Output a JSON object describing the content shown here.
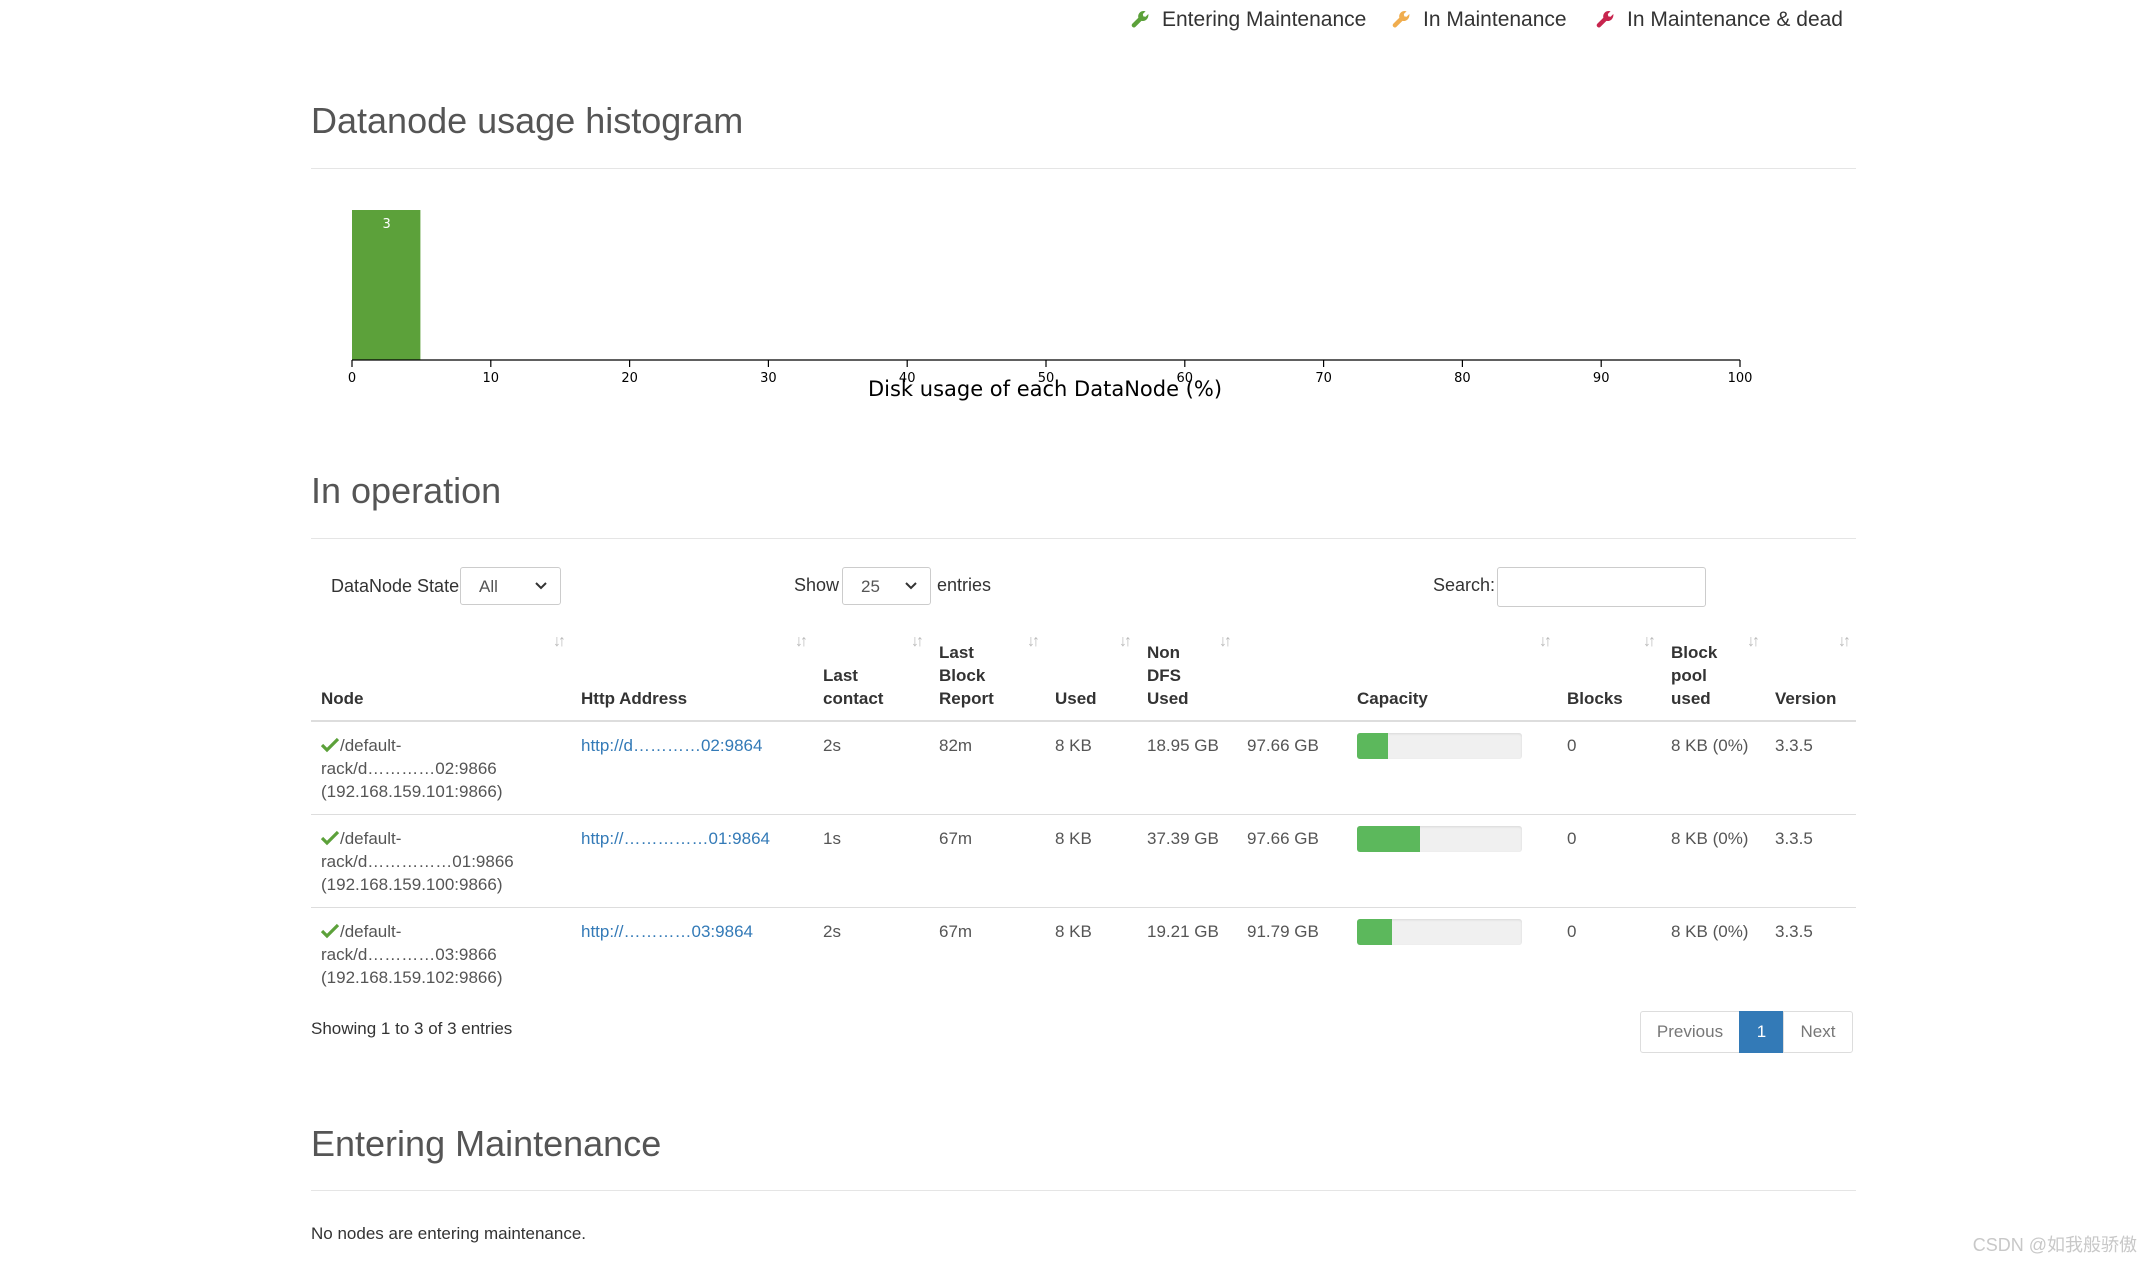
{
  "legend": {
    "entering": {
      "label": "Entering Maintenance",
      "color": "#5ca13a"
    },
    "in": {
      "label": "In Maintenance",
      "color": "#f0ad4e"
    },
    "dead": {
      "label": "In Maintenance & dead",
      "color": "#d9534f"
    }
  },
  "histogram": {
    "title": "Datanode usage histogram",
    "chart_data": {
      "type": "bar",
      "title": "",
      "xlabel": "Disk usage of each DataNode (%)",
      "ylabel": "",
      "xlim": [
        0,
        100
      ],
      "x_ticks": [
        "0",
        "10",
        "20",
        "30",
        "40",
        "50",
        "60",
        "70",
        "80",
        "90",
        "100"
      ],
      "bins": [
        {
          "start": 0,
          "end": 5,
          "value": 3
        }
      ],
      "bar_color": "#5ca13a"
    }
  },
  "in_operation": {
    "title": "In operation",
    "state_label": "DataNode State",
    "state_value": "All",
    "show_label": "Show",
    "show_value": "25",
    "entries_label": "entries",
    "search_label": "Search:",
    "search_value": "",
    "columns": {
      "node": "Node",
      "http": "Http Address",
      "last_contact": [
        "Last",
        "contact"
      ],
      "last_block": [
        "Last",
        "Block",
        "Report"
      ],
      "used": "Used",
      "non_dfs": [
        "Non",
        "DFS",
        "Used"
      ],
      "capacity": "Capacity",
      "blocks": "Blocks",
      "block_pool": [
        "Block",
        "pool",
        "used"
      ],
      "version": "Version"
    },
    "rows": [
      {
        "node_line1": "/default-",
        "node_line2": "rack/d…………02:9866",
        "node_line3": "(192.168.159.101:9866)",
        "http": "http://d…………02:9864",
        "last_contact": "2s",
        "last_block": "82m",
        "used": "8 KB",
        "non_dfs": "18.95 GB",
        "capacity": "97.66 GB",
        "capacity_pct": 19,
        "blocks": "0",
        "block_pool": "8 KB (0%)",
        "version": "3.3.5"
      },
      {
        "node_line1": "/default-",
        "node_line2": "rack/d……………01:9866",
        "node_line3": "(192.168.159.100:9866)",
        "http": "http://……………01:9864",
        "last_contact": "1s",
        "last_block": "67m",
        "used": "8 KB",
        "non_dfs": "37.39 GB",
        "capacity": "97.66 GB",
        "capacity_pct": 38,
        "blocks": "0",
        "block_pool": "8 KB (0%)",
        "version": "3.3.5"
      },
      {
        "node_line1": "/default-",
        "node_line2": "rack/d…………03:9866",
        "node_line3": "(192.168.159.102:9866)",
        "http": "http://…………03:9864",
        "last_contact": "2s",
        "last_block": "67m",
        "used": "8 KB",
        "non_dfs": "19.21 GB",
        "capacity": "91.79 GB",
        "capacity_pct": 21,
        "blocks": "0",
        "block_pool": "8 KB (0%)",
        "version": "3.3.5"
      }
    ],
    "showing": "Showing 1 to 3 of 3 entries",
    "pager": {
      "previous": "Previous",
      "current": "1",
      "next": "Next"
    }
  },
  "entering_maintenance": {
    "title": "Entering Maintenance",
    "message": "No nodes are entering maintenance."
  },
  "watermark": "CSDN @如我般骄傲"
}
